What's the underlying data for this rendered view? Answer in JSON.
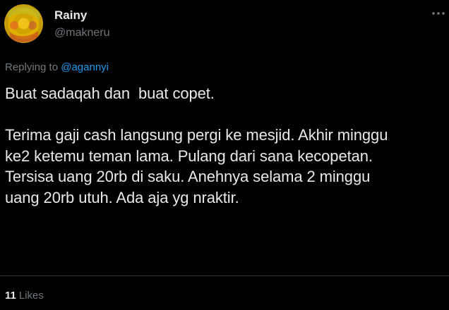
{
  "author": {
    "display_name": "Rainy",
    "handle": "@makneru",
    "avatar_icon": "avatar-image"
  },
  "reply": {
    "prefix": "Replying to ",
    "mention": "@agannyi"
  },
  "tweet": {
    "text": "Buat sadaqah dan  buat copet.\n\nTerima gaji cash langsung pergi ke mesjid. Akhir minggu\nke2 ketemu teman lama. Pulang dari sana kecopetan.\nTersisa uang 20rb di saku. Anehnya selama 2 minggu\nuang 20rb utuh. Ada aja yg nraktir."
  },
  "stats": {
    "likes_count": "11",
    "likes_label": "Likes"
  },
  "colors": {
    "background": "#000000",
    "text_primary": "#e7e9ea",
    "text_secondary": "#71767b",
    "accent": "#1d9bf0"
  }
}
